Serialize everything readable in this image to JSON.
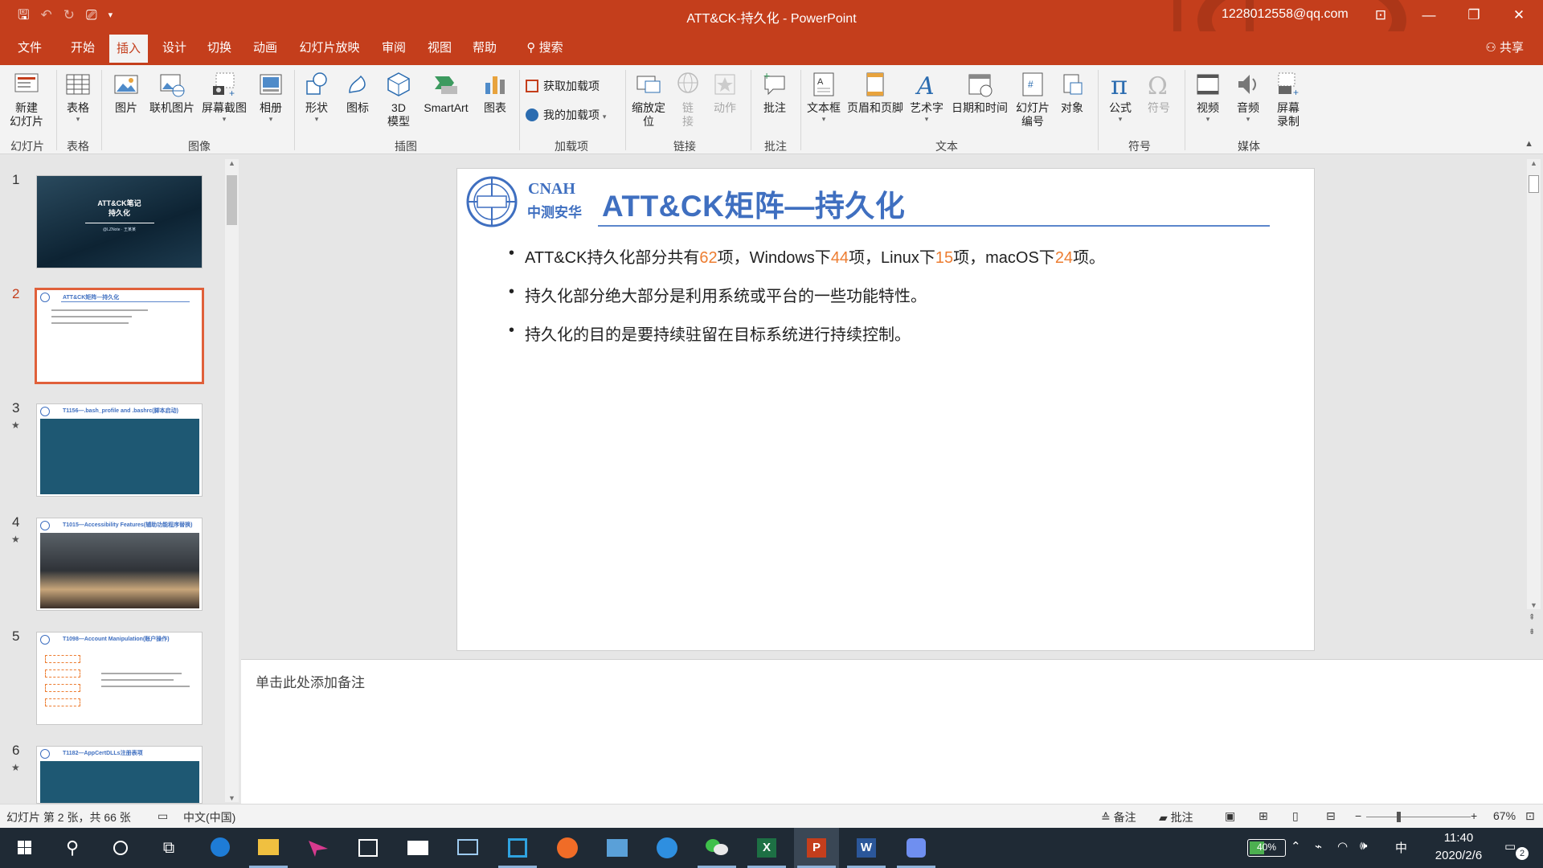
{
  "window": {
    "title": "ATT&CK-持久化 - PowerPoint",
    "user": "1228012558@qq.com"
  },
  "tabs": [
    "文件",
    "开始",
    "插入",
    "设计",
    "切换",
    "动画",
    "幻灯片放映",
    "审阅",
    "视图",
    "帮助",
    "搜索"
  ],
  "share_label": "共享",
  "ribbon": {
    "new_slide": "新建\n幻灯片",
    "table": "表格",
    "picture": "图片",
    "online_picture": "联机图片",
    "screenshot": "屏幕截图",
    "album": "相册",
    "shapes": "形状",
    "icons": "图标",
    "model3d": "3D\n模型",
    "smartart": "SmartArt",
    "chart": "图表",
    "get_addins": "获取加载项",
    "my_addins": "我的加载项",
    "zoom": "缩放定\n位",
    "link": "链\n接",
    "action": "动作",
    "comment": "批注",
    "textbox": "文本框",
    "header_footer": "页眉和页脚",
    "wordart": "艺术字",
    "datetime": "日期和时间",
    "slide_number": "幻灯片\n编号",
    "object": "对象",
    "equation": "公式",
    "symbol": "符号",
    "video": "视频",
    "audio": "音频",
    "screen_record": "屏幕\n录制",
    "groups": {
      "slides": "幻灯片",
      "tables": "表格",
      "images": "图像",
      "illustrations": "插图",
      "addins": "加载项",
      "links": "链接",
      "comments": "批注",
      "text": "文本",
      "symbols": "符号",
      "media": "媒体"
    }
  },
  "thumbnails": [
    {
      "num": "1",
      "title": "ATT&CK笔记\n持久化",
      "subtitle": "@LZNote · 王某某"
    },
    {
      "num": "2",
      "title": "ATT&CK矩阵—持久化"
    },
    {
      "num": "3",
      "title": "T1156—.bash_profile and .bashrc(脚本启动)"
    },
    {
      "num": "4",
      "title": "T1015—Accessibility Features(辅助功能程序替换)"
    },
    {
      "num": "5",
      "title": "T1098—Account Manipulation(账户操作)"
    },
    {
      "num": "6",
      "title": "T1182—AppCertDLLs注册表项"
    }
  ],
  "slide": {
    "logo_en": "CNAH",
    "logo_cn": "中测安华",
    "title": "ATT&CK矩阵—持久化",
    "bullet1": {
      "t1": "ATT&CK持久化部分共有",
      "n1": "62",
      "t2": "项，Windows下",
      "n2": "44",
      "t3": "项，Linux下",
      "n3": "15",
      "t4": "项，macOS下",
      "n4": "24",
      "t5": "项。"
    },
    "bullet2": "持久化部分绝大部分是利用系统或平台的一些功能特性。",
    "bullet3": "持久化的目的是要持续驻留在目标系统进行持续控制。",
    "bullet_char": "•"
  },
  "notes_placeholder": "单击此处添加备注",
  "status": {
    "slide_info": "幻灯片 第 2 张，共 66 张",
    "language": "中文(中国)",
    "notes": "备注",
    "comments": "批注",
    "zoom": "67%"
  },
  "taskbar": {
    "battery": "40%",
    "ime": "中",
    "time": "11:40",
    "date": "2020/2/6",
    "notifications": "2"
  },
  "colors": {
    "ppt_red": "#c43e1c",
    "title_blue": "#3f6fc0",
    "number_orange": "#ed7d31"
  }
}
